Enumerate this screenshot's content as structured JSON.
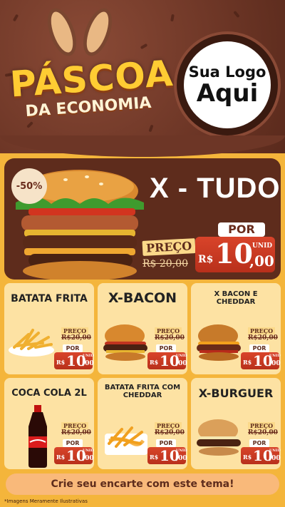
{
  "header": {
    "brand_line1": "PÁSCOA",
    "brand_line2": "DA ECONOMIA",
    "logo_line1": "Sua Logo",
    "logo_line2": "Aqui"
  },
  "hero": {
    "discount": "-50%",
    "title": "X - TUDO",
    "price_label": "PREÇO",
    "old_price": "R$ 20,00",
    "por": "POR",
    "currency": "R$",
    "price_whole": "10",
    "price_cents": ",00",
    "unit": "UNID"
  },
  "products": [
    {
      "name": "BATATA FRITA",
      "price_label": "PREÇO",
      "old_price": "R$20,00",
      "por": "POR",
      "currency": "R$",
      "price_whole": "10",
      "price_cents": ",00",
      "unit": "UNID"
    },
    {
      "name": "X-BACON",
      "price_label": "PREÇO",
      "old_price": "R$20,00",
      "por": "POR",
      "currency": "R$",
      "price_whole": "10",
      "price_cents": ",00",
      "unit": "UNID"
    },
    {
      "name": "X BACON E CHEDDAR",
      "price_label": "PREÇO",
      "old_price": "R$20,00",
      "por": "POR",
      "currency": "R$",
      "price_whole": "10",
      "price_cents": ",00",
      "unit": "UNID"
    },
    {
      "name": "COCA COLA 2L",
      "price_label": "PREÇO",
      "old_price": "R$20,00",
      "por": "POR",
      "currency": "R$",
      "price_whole": "10",
      "price_cents": ",00",
      "unit": "UNID"
    },
    {
      "name": "BATATA FRITA COM CHEDDAR",
      "price_label": "PREÇO",
      "old_price": "R$20,00",
      "por": "POR",
      "currency": "R$",
      "price_whole": "10",
      "price_cents": ",00",
      "unit": "UNID"
    },
    {
      "name": "X-BURGUER",
      "price_label": "PREÇO",
      "old_price": "R$20,00",
      "por": "POR",
      "currency": "R$",
      "price_whole": "10",
      "price_cents": ",00",
      "unit": "UNID"
    }
  ],
  "footer": {
    "cta": "Crie seu encarte com este tema!",
    "disclaimer": "*Imagens Meramente Ilustrativas"
  },
  "colors": {
    "chocolate": "#5e2c1c",
    "cream": "#fde2a3",
    "price_red": "#c73a22",
    "background": "#f4b53b"
  }
}
